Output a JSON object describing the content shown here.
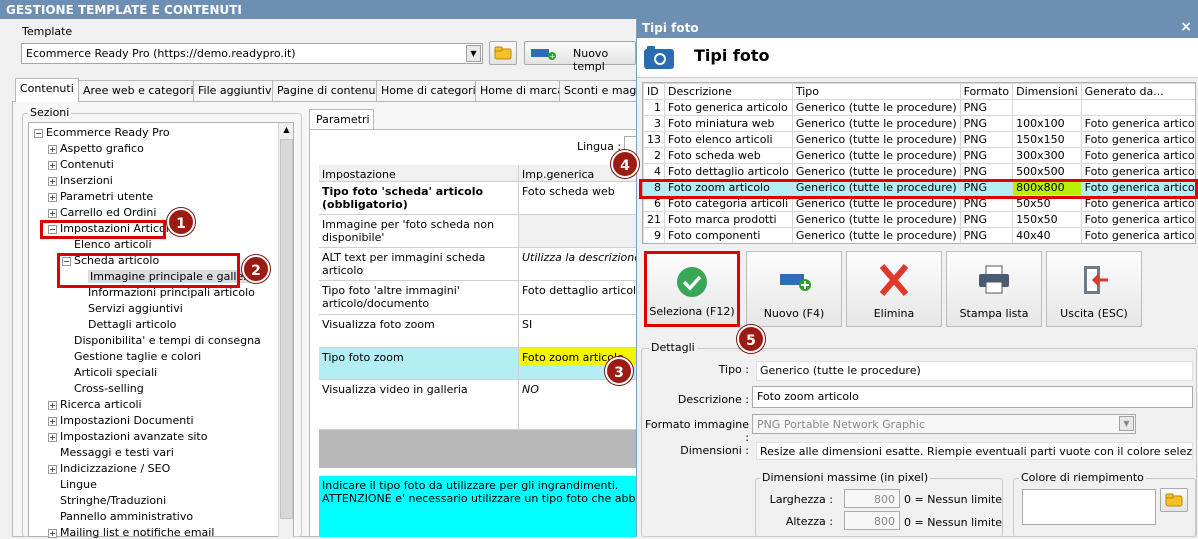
{
  "main": {
    "title": "GESTIONE TEMPLATE E CONTENUTI",
    "template_label": "Template",
    "template_value": "Ecommerce Ready Pro (https://demo.readypro.it)",
    "new_template_label": "Nuovo templ",
    "tabs": [
      "Contenuti",
      "Aree web e categorie",
      "File aggiuntivi",
      "Pagine di contenuti",
      "Home di categoria",
      "Home di marca",
      "Sconti e maggi"
    ],
    "sections_label": "Sezioni",
    "tree": [
      {
        "label": "Ecommerce Ready Pro",
        "exp": "−"
      },
      {
        "label": "Aspetto grafico",
        "exp": "+"
      },
      {
        "label": "Contenuti",
        "exp": "+"
      },
      {
        "label": "Inserzioni",
        "exp": "+"
      },
      {
        "label": "Parametri utente",
        "exp": "+"
      },
      {
        "label": "Carrello ed Ordini",
        "exp": "+"
      },
      {
        "label": "Impostazioni Articoli",
        "exp": "−"
      },
      {
        "label": "Elenco articoli",
        "exp": ""
      },
      {
        "label": "Scheda articolo",
        "exp": "−"
      },
      {
        "label": "Immagine principale e galleria",
        "exp": ""
      },
      {
        "label": "Informazioni principali articolo",
        "exp": ""
      },
      {
        "label": "Servizi aggiuntivi",
        "exp": ""
      },
      {
        "label": "Dettagli articolo",
        "exp": ""
      },
      {
        "label": "Disponibilita' e tempi di consegna",
        "exp": ""
      },
      {
        "label": "Gestione taglie e colori",
        "exp": ""
      },
      {
        "label": "Articoli speciali",
        "exp": ""
      },
      {
        "label": "Cross-selling",
        "exp": ""
      },
      {
        "label": "Ricerca articoli",
        "exp": "+"
      },
      {
        "label": "Impostazioni Documenti",
        "exp": "+"
      },
      {
        "label": "Impostazioni avanzate sito",
        "exp": "+"
      },
      {
        "label": "Messaggi e testi vari",
        "exp": ""
      },
      {
        "label": "Indicizzazione / SEO",
        "exp": "+"
      },
      {
        "label": "Lingue",
        "exp": ""
      },
      {
        "label": "Stringhe/Traduzioni",
        "exp": ""
      },
      {
        "label": "Pannello amministrativo",
        "exp": ""
      },
      {
        "label": "Mailing list e notifiche email",
        "exp": "+"
      }
    ],
    "params_tab": "Parametri",
    "lingua_label": "Lingua :",
    "param_headers": [
      "Impostazione",
      "Imp.generica"
    ],
    "params": [
      {
        "name": "Tipo foto 'scheda' articolo (obbligatorio)",
        "value": "Foto scheda web"
      },
      {
        "name": "Immagine per 'foto scheda non disponibile'",
        "value": ""
      },
      {
        "name": "ALT text per immagini scheda articolo",
        "value": "Utilizza la descrizione de"
      },
      {
        "name": "Tipo foto 'altre immagini' articolo/documento",
        "value": "Foto dettaglio articolo"
      },
      {
        "name": "Visualizza foto zoom",
        "value": "SI"
      },
      {
        "name": "Tipo foto zoom",
        "value": "Foto zoom articolo"
      },
      {
        "name": "Visualizza video in galleria",
        "value": "NO"
      }
    ],
    "help_text": "Indicare il tipo foto da utilizzare per gli ingrandimenti.\nATTENZIONE e' necessario utilizzare un tipo foto che abbia lo stes"
  },
  "markers": [
    "1",
    "2",
    "3",
    "4",
    "5"
  ],
  "dialog": {
    "title": "Tipi foto",
    "heading": "Tipi foto",
    "close": "×",
    "columns": [
      "ID",
      "Descrizione",
      "Tipo",
      "Formato",
      "Dimensioni",
      "Generato da..."
    ],
    "rows": [
      {
        "id": "1",
        "desc": "Foto generica articolo",
        "tipo": "Generico (tutte le procedure)",
        "formato": "PNG",
        "dim": "",
        "gen": ""
      },
      {
        "id": "3",
        "desc": "Foto miniatura web",
        "tipo": "Generico (tutte le procedure)",
        "formato": "PNG",
        "dim": "100x100",
        "gen": "Foto generica articolo"
      },
      {
        "id": "13",
        "desc": "Foto elenco articoli",
        "tipo": "Generico (tutte le procedure)",
        "formato": "PNG",
        "dim": "150x150",
        "gen": "Foto generica articolo"
      },
      {
        "id": "2",
        "desc": "Foto scheda web",
        "tipo": "Generico (tutte le procedure)",
        "formato": "PNG",
        "dim": "300x300",
        "gen": "Foto generica articolo"
      },
      {
        "id": "4",
        "desc": "Foto dettaglio articolo",
        "tipo": "Generico (tutte le procedure)",
        "formato": "PNG",
        "dim": "500x500",
        "gen": "Foto generica articolo"
      },
      {
        "id": "8",
        "desc": "Foto zoom articolo",
        "tipo": "Generico (tutte le procedure)",
        "formato": "PNG",
        "dim": "800x800",
        "gen": "Foto generica articolo"
      },
      {
        "id": "6",
        "desc": "Foto categoria articoli",
        "tipo": "Generico (tutte le procedure)",
        "formato": "PNG",
        "dim": "50x50",
        "gen": "Foto generica articolo"
      },
      {
        "id": "21",
        "desc": "Foto marca prodotti",
        "tipo": "Generico (tutte le procedure)",
        "formato": "PNG",
        "dim": "150x50",
        "gen": "Foto generica articolo"
      },
      {
        "id": "9",
        "desc": "Foto componenti",
        "tipo": "Generico (tutte le procedure)",
        "formato": "PNG",
        "dim": "40x40",
        "gen": "Foto generica articolo"
      }
    ],
    "selected_row": 5,
    "buttons": {
      "select": "Seleziona (F12)",
      "new": "Nuovo (F4)",
      "delete": "Elimina",
      "print": "Stampa lista",
      "exit": "Uscita (ESC)"
    },
    "details": {
      "group": "Dettagli",
      "tipo_label": "Tipo :",
      "tipo_value": "Generico (tutte le procedure)",
      "descrizione_label": "Descrizione :",
      "descrizione_value": "Foto zoom articolo",
      "formato_label": "Formato immagine :",
      "formato_value": "PNG Portable Network Graphic",
      "dimensioni_label": "Dimensioni :",
      "dimensioni_value": "Resize alle dimensioni esatte. Riempie eventuali parti vuote con il colore selezionato.",
      "max_group": "Dimensioni massime (in pixel)",
      "larghezza_label": "Larghezza :",
      "larghezza_value": "800",
      "altezza_label": "Altezza :",
      "altezza_value": "800",
      "no_limit": "0 = Nessun limite",
      "fill_group": "Colore di riempimento"
    }
  }
}
